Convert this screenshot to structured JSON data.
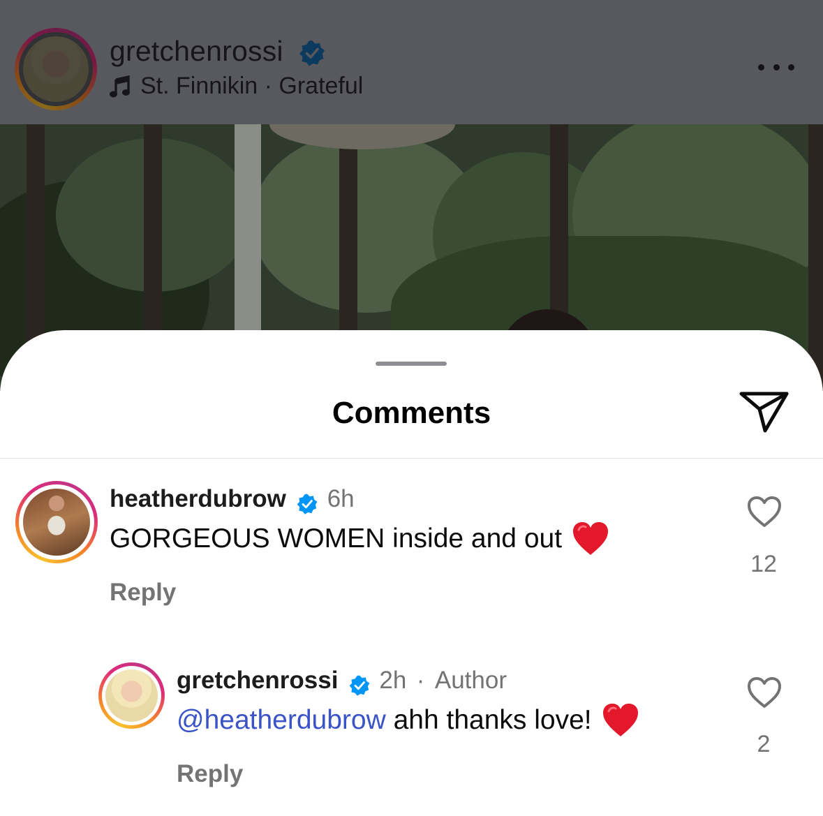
{
  "post": {
    "username": "gretchenrossi",
    "song": "St. Finnikin · Grateful",
    "icons": {
      "verified": "verified-badge-icon",
      "music": "music-note-icon",
      "more": "more-options-icon"
    }
  },
  "sheet": {
    "title": "Comments",
    "share_icon": "send-icon"
  },
  "comments": [
    {
      "username": "heatherdubrow",
      "time": "6h",
      "text": "GORGEOUS WOMEN inside and out",
      "emoji": "❤️",
      "reply_label": "Reply",
      "likes": "12"
    },
    {
      "username": "gretchenrossi",
      "time": "2h",
      "author_badge": "Author",
      "mention": "@heatherdubrow",
      "text": " ahh thanks love!",
      "emoji": "❤️",
      "reply_label": "Reply",
      "likes": "2"
    }
  ],
  "colors": {
    "accent_blue": "#0095f6",
    "mention": "#3a53c7",
    "secondary_text": "#737373",
    "heart_red": "#e3192b"
  }
}
